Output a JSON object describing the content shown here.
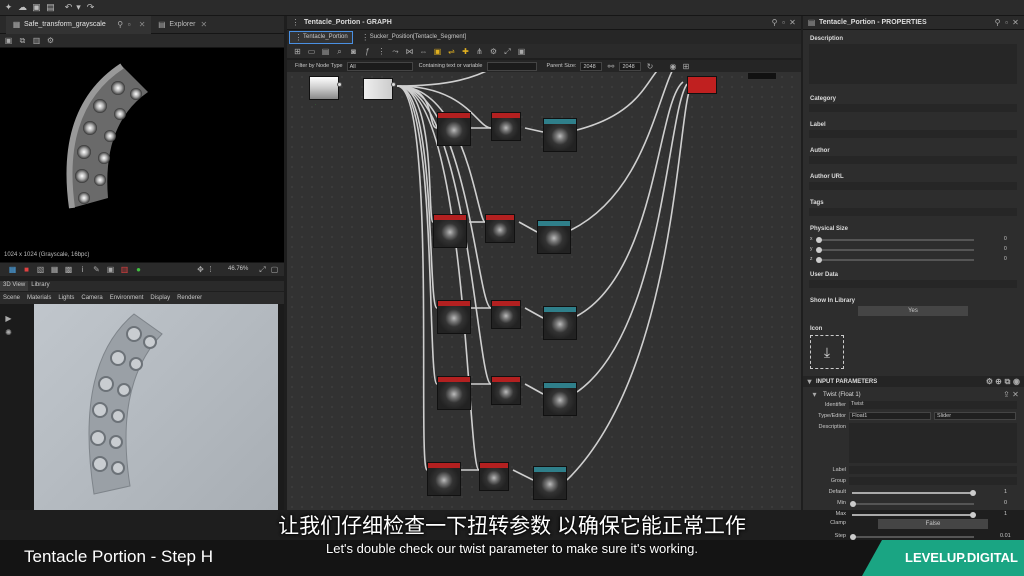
{
  "left_panel": {
    "tab_title": "Safe_transform_grayscale",
    "explorer_tab": "Explorer",
    "image_info": "1024 x 1024 (Grayscale, 16bpc)",
    "zoom": "46.76%"
  },
  "view3d": {
    "tabs": [
      "3D View",
      "Library"
    ],
    "menu": [
      "Scene",
      "Materials",
      "Lights",
      "Camera",
      "Environment",
      "Display",
      "Renderer"
    ]
  },
  "graph": {
    "title": "Tentacle_Portion - GRAPH",
    "tab1": "Tentacle_Portion",
    "tab2": "Sucker_Position[Tentacle_Segment]",
    "filter_label": "Filter by Node Type",
    "filter_value": "All",
    "containing_label": "Containing text or variable",
    "parent_size_label": "Parent Size:",
    "parent_size_value": "2048",
    "size_value": "2048"
  },
  "properties": {
    "title": "Tentacle_Portion - PROPERTIES",
    "description": "Description",
    "category": "Category",
    "label": "Label",
    "author": "Author",
    "author_url": "Author URL",
    "tags": "Tags",
    "physical_size": "Physical Size",
    "axes": [
      "x",
      "y",
      "z"
    ],
    "axis_values": [
      "0",
      "0",
      "0"
    ],
    "user_data": "User Data",
    "show_in_library": "Show In Library",
    "show_in_library_value": "Yes",
    "icon": "Icon",
    "input_parameters": "INPUT PARAMETERS",
    "param_name": "Twist (Float 1)",
    "identifier_label": "Identifier",
    "identifier_value": "Twist",
    "type_editor_label": "Type/Editor",
    "type_value": "Float1",
    "editor_value": "Slider",
    "param_description": "Description",
    "param_label": "Label",
    "group": "Group",
    "default_label": "Default",
    "default_value": "1",
    "min_label": "Min",
    "min_value": "0",
    "max_label": "Max",
    "max_value": "1",
    "clamp_label": "Clamp",
    "clamp_value": "False",
    "step_label": "Step",
    "step_value": "0.01"
  },
  "subtitles": {
    "chinese": "让我们仔细检查一下扭转参数 以确保它能正常工作",
    "english": "Let's double check our twist parameter to make sure it's working."
  },
  "footer": {
    "step_title": "Tentacle Portion - Step H",
    "brand": "LEVELUP.DIGITAL"
  },
  "colors": {
    "accent": "#1aa583",
    "node_red": "#b32020",
    "node_teal": "#2f7f8a"
  }
}
